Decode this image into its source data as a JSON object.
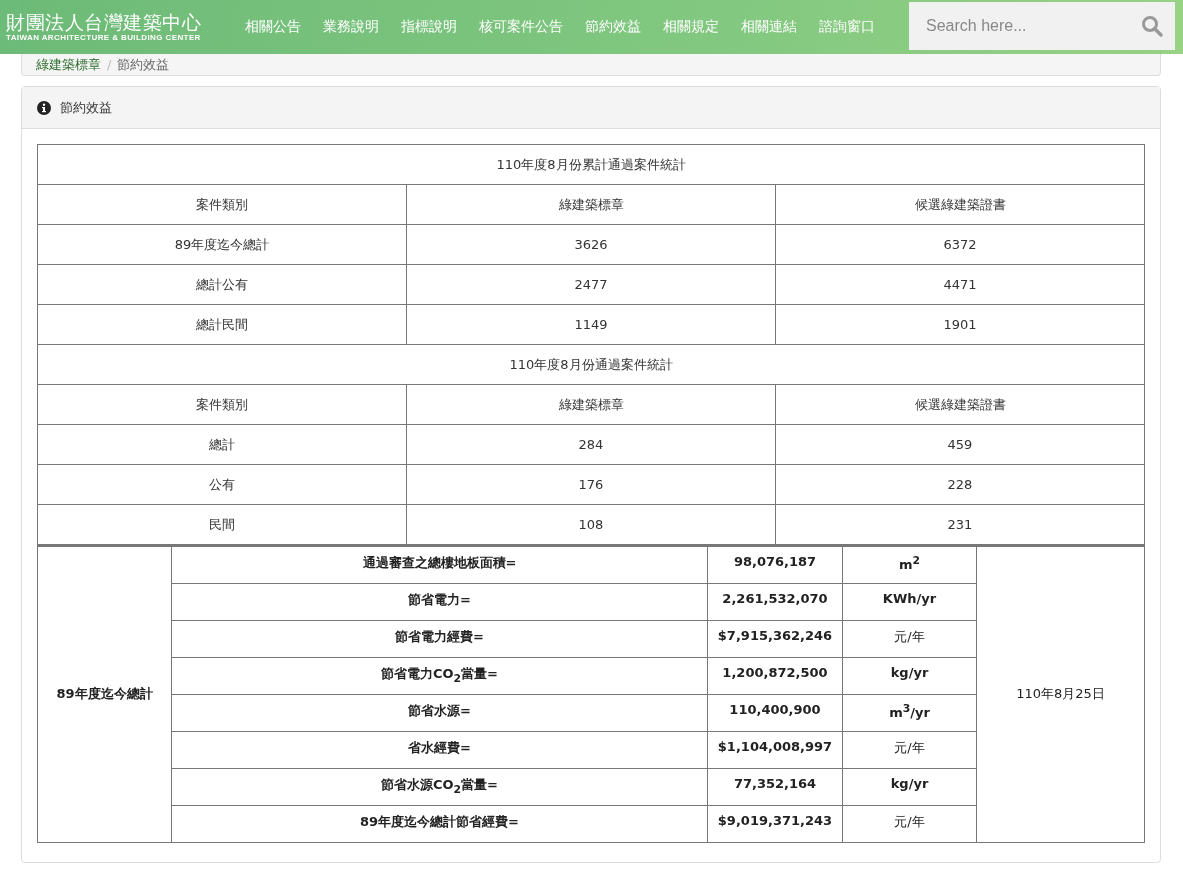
{
  "header": {
    "logo_title": "財團法人台灣建築中心",
    "logo_subtitle": "TAIWAN ARCHITECTURE & BUILDING CENTER",
    "nav": [
      "相關公告",
      "業務說明",
      "指標說明",
      "核可案件公告",
      "節約效益",
      "相關規定",
      "相關連結",
      "諮詢窗口"
    ],
    "search": {
      "placeholder": "Search here..."
    }
  },
  "breadcrumb": [
    "綠建築標章",
    "節約效益"
  ],
  "breadcrumb_separator": "/",
  "panel": {
    "title": "節約效益",
    "stats_tables": [
      {
        "title": "110年度8月份累計通過案件統計",
        "columns": [
          "案件類別",
          "綠建築標章",
          "候選綠建築證書"
        ],
        "rows": [
          [
            "89年度迄今總計",
            "3626",
            "6372"
          ],
          [
            "總計公有",
            "2477",
            "4471"
          ],
          [
            "總計民間",
            "1149",
            "1901"
          ]
        ]
      },
      {
        "title": "110年度8月份通過案件統計",
        "columns": [
          "案件類別",
          "綠建築標章",
          "候選綠建築證書"
        ],
        "rows": [
          [
            "總計",
            "284",
            "459"
          ],
          [
            "公有",
            "176",
            "228"
          ],
          [
            "民間",
            "108",
            "231"
          ]
        ]
      }
    ],
    "savings": {
      "group_label": "89年度迄今總計",
      "date": "110年8月25日",
      "rows": [
        {
          "label": "通過審查之總樓地板面積=",
          "value": "98,076,187",
          "unit": "m$^{2}$",
          "unit_bold": true
        },
        {
          "label": "節省電力=",
          "value": "2,261,532,070",
          "unit": "KWh/yr",
          "unit_bold": true
        },
        {
          "label": "節省電力經費=",
          "value": "$7,915,362,246",
          "unit": "元/年",
          "unit_bold": false
        },
        {
          "label": "節省電力CO$_{2}$當量=",
          "value": "1,200,872,500",
          "unit": "kg/yr",
          "unit_bold": true
        },
        {
          "label": "節省水源=",
          "value": "110,400,900",
          "unit": "m$^{3}$/yr",
          "unit_bold": true
        },
        {
          "label": "省水經費=",
          "value": "$1,104,008,997",
          "unit": "元/年",
          "unit_bold": false
        },
        {
          "label": "節省水源CO$_{2}$當量=",
          "value": "77,352,164",
          "unit": "kg/yr",
          "unit_bold": true
        },
        {
          "label": "89年度迄今總計節省經費=",
          "value": "$9,019,371,243",
          "unit": "元/年",
          "unit_bold": false
        }
      ]
    }
  }
}
